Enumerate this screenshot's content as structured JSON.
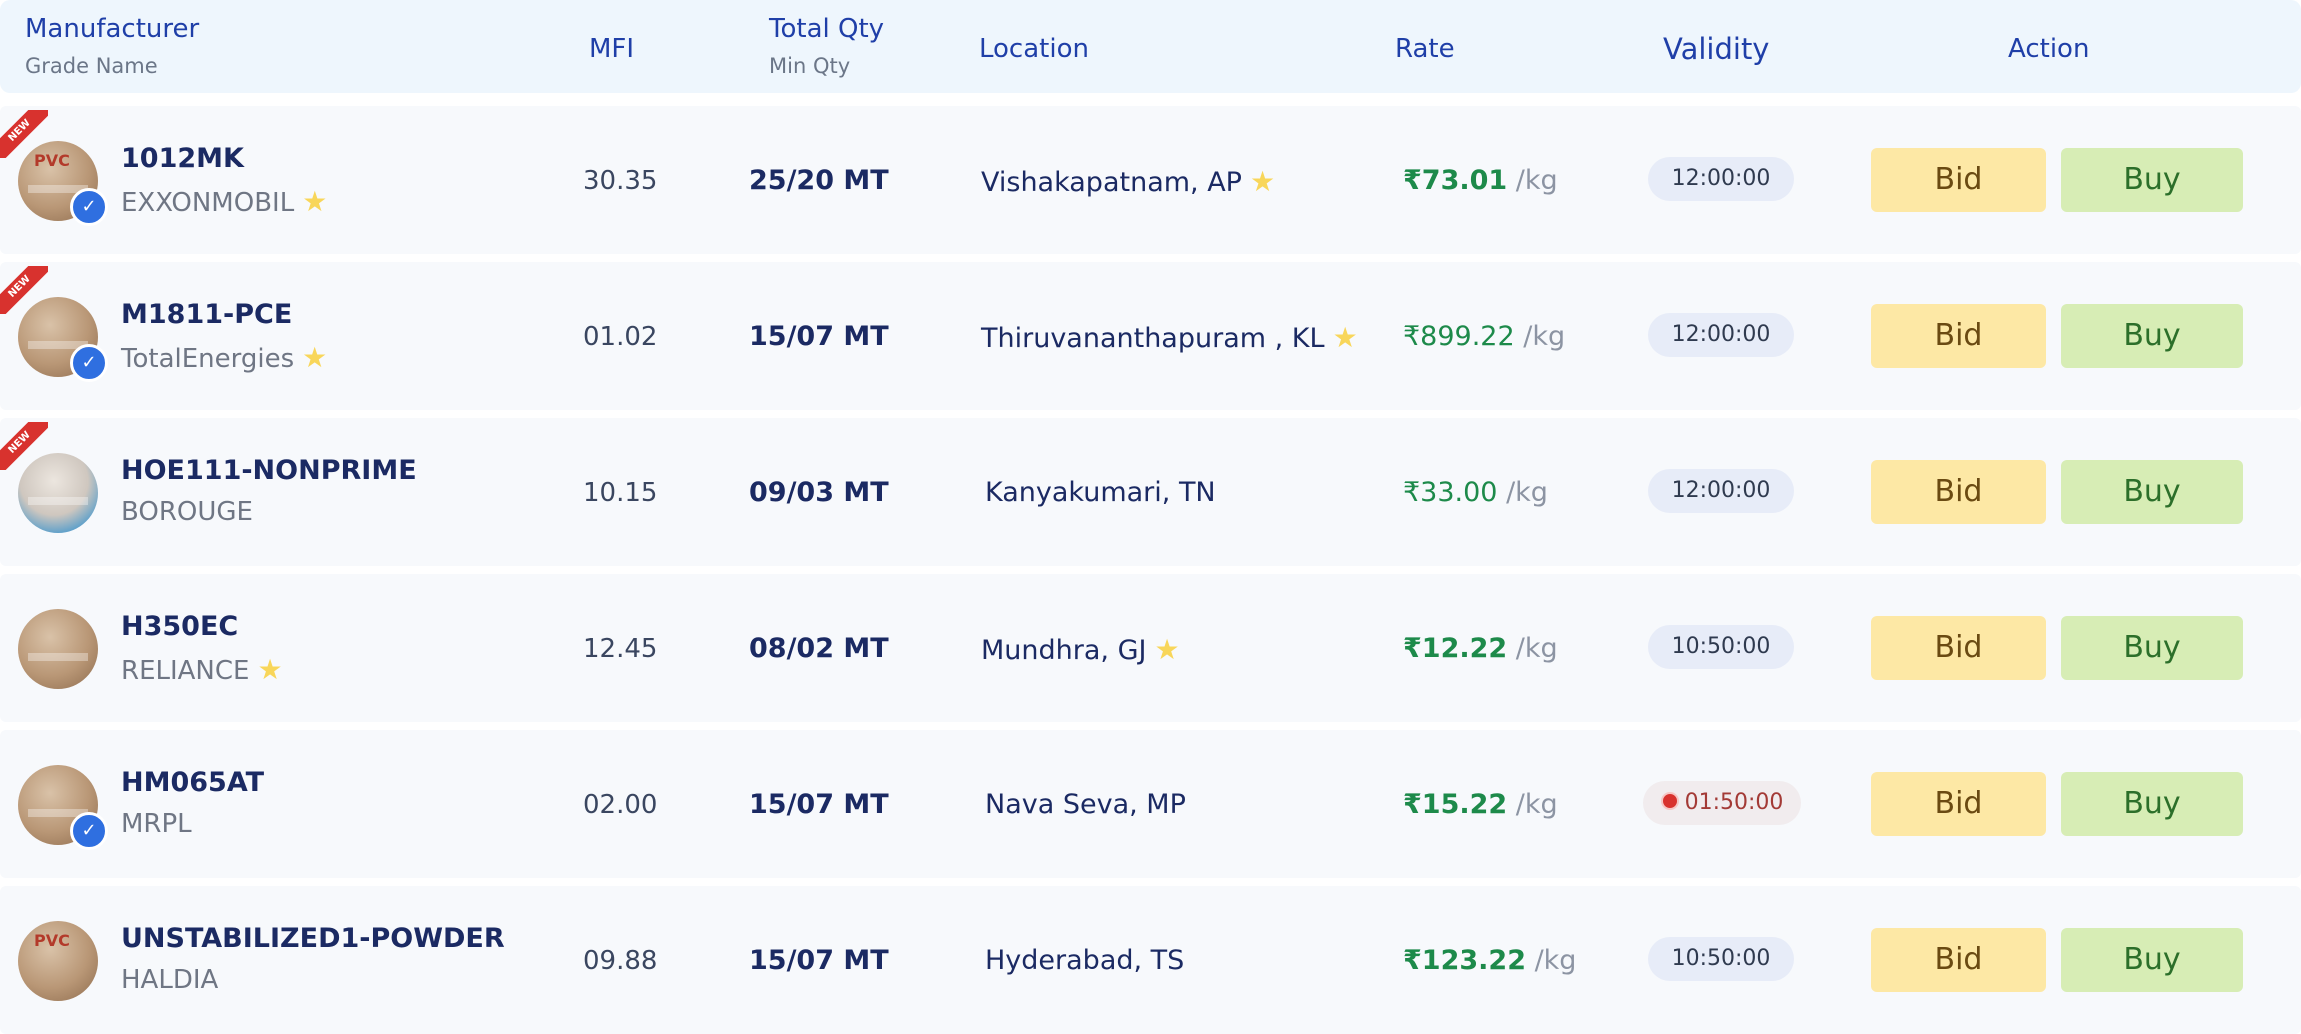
{
  "header": {
    "manufacturer": "Manufacturer",
    "grade_name": "Grade Name",
    "mfi": "MFI",
    "total_qty": "Total Qty",
    "min_qty": "Min Qty",
    "location": "Location",
    "rate": "Rate",
    "validity": "Validity",
    "action": "Action"
  },
  "badges": {
    "new": "NEW",
    "verified_icon": "check-badge-icon",
    "star_icon": "star-icon"
  },
  "colors": {
    "header_bg": "#eef6fd",
    "accent": "#1f3fa8",
    "rate_green": "#1d8a4a",
    "bid_bg": "#fde8a5",
    "buy_bg": "#d7edb5",
    "new_ribbon": "#d8322e"
  },
  "rows": [
    {
      "grade": "1012MK",
      "manufacturer": "EXXONMOBIL",
      "mfi": "30.35",
      "qty": "25/20 MT",
      "location": "Vishakapatnam, AP",
      "rate": "₹73.01",
      "unit": "/kg",
      "validity": "12:00:00",
      "bid": "Bid",
      "buy": "Buy",
      "is_new": true,
      "verified": true,
      "starred_mfr": true,
      "starred_loc": true,
      "rate_bold": true
    },
    {
      "grade": "M1811-PCE",
      "manufacturer": "TotalEnergies",
      "mfi": "01.02",
      "qty": "15/07 MT",
      "location": "Thiruvananthapuram , KL",
      "rate": "₹899.22",
      "unit": "/kg",
      "validity": "12:00:00",
      "bid": "Bid",
      "buy": "Buy",
      "is_new": true,
      "verified": true,
      "starred_mfr": true,
      "starred_loc": true,
      "rate_bold": false
    },
    {
      "grade": "HOE111-NONPRIME",
      "manufacturer": "BOROUGE",
      "mfi": "10.15",
      "qty": "09/03 MT",
      "location": "Kanyakumari, TN",
      "rate": "₹33.00",
      "unit": "/kg",
      "validity": "12:00:00",
      "bid": "Bid",
      "buy": "Buy",
      "is_new": true,
      "verified": false,
      "starred_mfr": false,
      "starred_loc": false,
      "rate_bold": false
    },
    {
      "grade": "H350EC",
      "manufacturer": "RELIANCE",
      "mfi": "12.45",
      "qty": "08/02 MT",
      "location": "Mundhra, GJ",
      "rate": "₹12.22",
      "unit": "/kg",
      "validity": "10:50:00",
      "bid": "Bid",
      "buy": "Buy",
      "is_new": false,
      "verified": false,
      "starred_mfr": true,
      "starred_loc": true,
      "rate_bold": true
    },
    {
      "grade": "HM065AT",
      "manufacturer": "MRPL",
      "mfi": "02.00",
      "qty": "15/07 MT",
      "location": "Nava Seva, MP",
      "rate": "₹15.22",
      "unit": "/kg",
      "validity": "01:50:00",
      "bid": "Bid",
      "buy": "Buy",
      "is_new": false,
      "verified": true,
      "starred_mfr": false,
      "starred_loc": false,
      "rate_bold": true,
      "urgent": true
    },
    {
      "grade": "UNSTABILIZED1-POWDER",
      "manufacturer": "HALDIA",
      "mfi": "09.88",
      "qty": "15/07 MT",
      "location": "Hyderabad, TS",
      "rate": "₹123.22",
      "unit": "/kg",
      "validity": "10:50:00",
      "bid": "Bid",
      "buy": "Buy",
      "is_new": false,
      "verified": false,
      "starred_mfr": false,
      "starred_loc": false,
      "rate_bold": true
    }
  ]
}
